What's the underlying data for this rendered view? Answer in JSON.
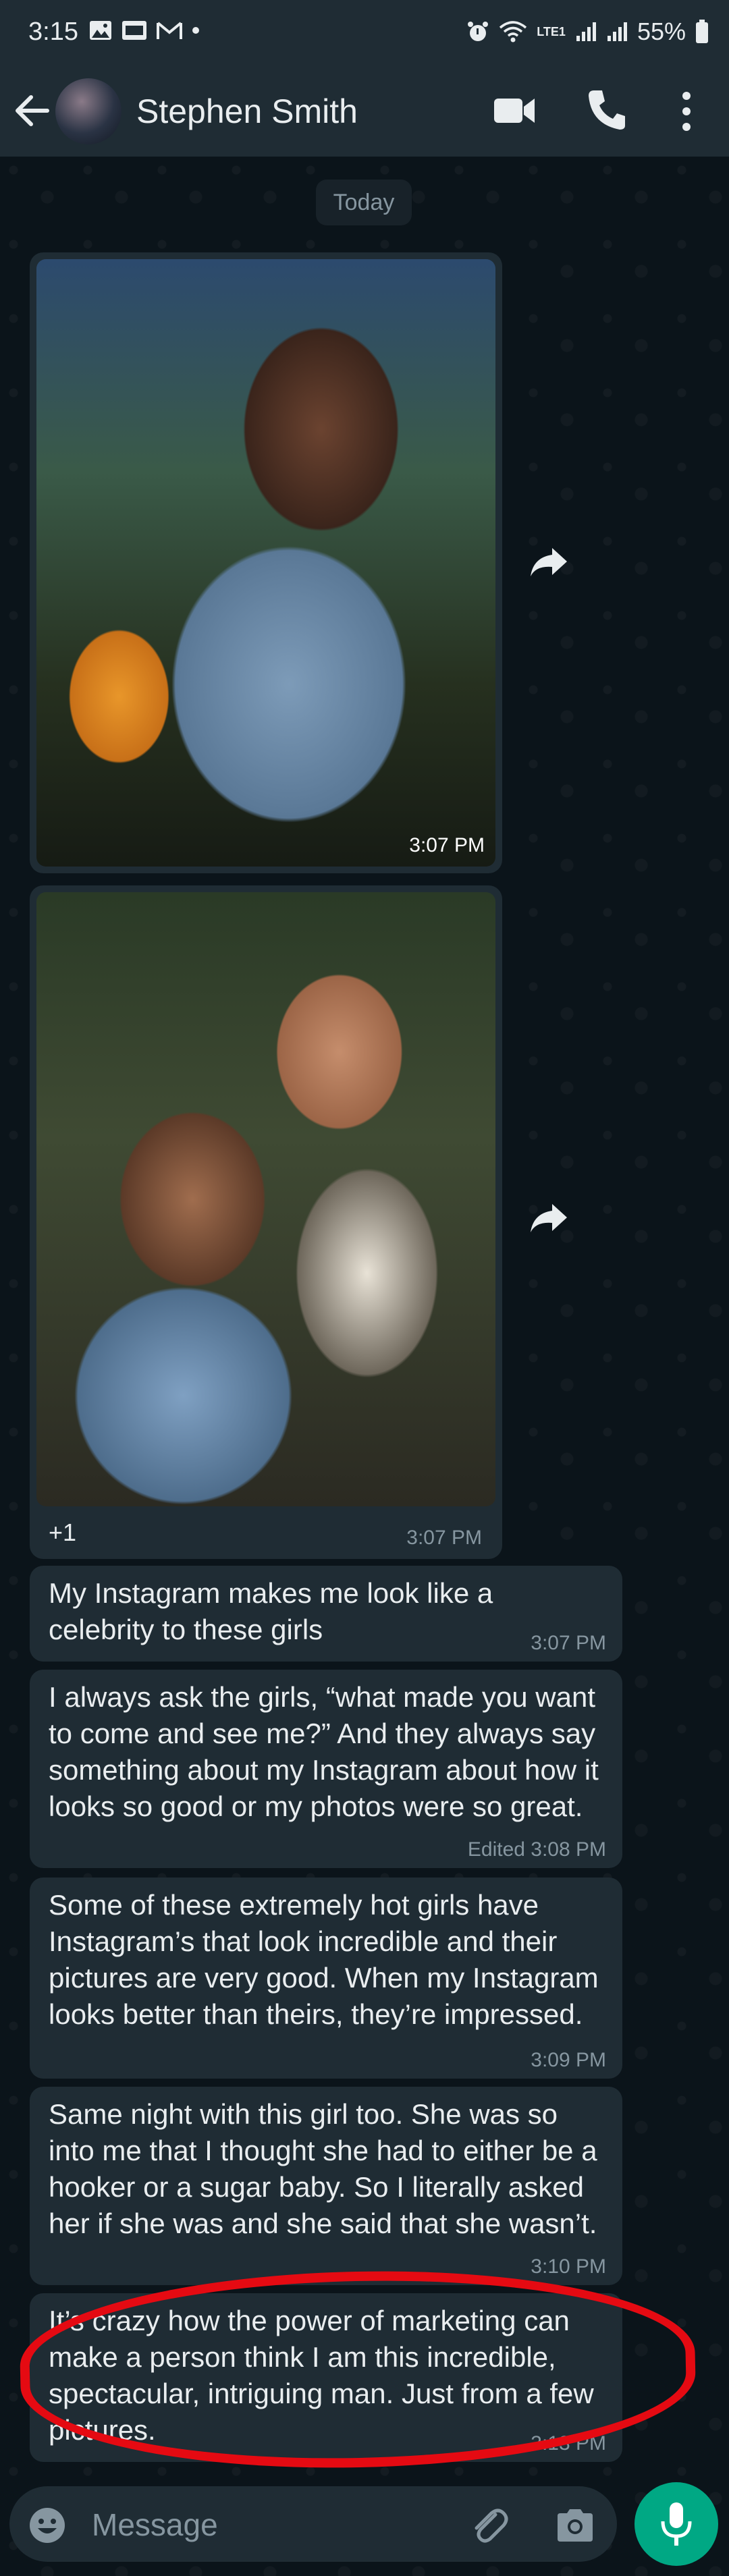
{
  "status_bar": {
    "time": "3:15",
    "lte_label": "LTE1",
    "battery": "55%"
  },
  "header": {
    "contact_name": "Stephen Smith"
  },
  "date_chip": "Today",
  "messages": [
    {
      "type": "image",
      "time": "3:07 PM"
    },
    {
      "type": "image-group",
      "extra_count": "+1",
      "time": "3:07 PM"
    },
    {
      "type": "text",
      "text": "My Instagram makes me look like a celebrity to these girls",
      "time": "3:07 PM"
    },
    {
      "type": "text",
      "text": "I always ask the girls, “what made you want to come and see me?” And they always say something about my Instagram about how it looks so good or my photos were so great.",
      "time": "Edited 3:08 PM"
    },
    {
      "type": "text",
      "text": "Some of these extremely hot girls have Instagram’s that look incredible and their pictures are very good. When my Instagram looks better than theirs, they’re impressed.",
      "time": "3:09 PM"
    },
    {
      "type": "text",
      "text": "Same night with this girl too. She was so into me that I thought she had to either be a hooker or a sugar baby. So I literally asked her if she was and she said that she wasn’t.",
      "time": "3:10 PM"
    },
    {
      "type": "text",
      "text": "It’s crazy how the power of marketing can make a person think I am this incredible, spectacular, intriguing man. Just from a few pictures.",
      "time": "3:13 PM",
      "highlighted": true
    }
  ],
  "input": {
    "placeholder": "Message",
    "value": ""
  },
  "colors": {
    "accent": "#00a884",
    "bubble": "#1f2c34",
    "background": "#0b141a",
    "highlight": "#e50a12"
  }
}
